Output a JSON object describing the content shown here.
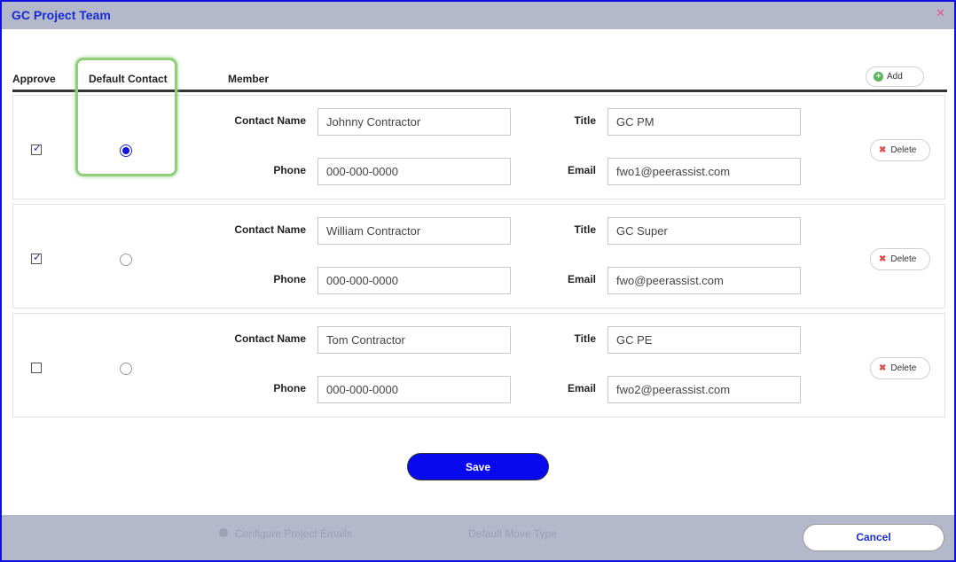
{
  "dialog": {
    "title": "GC Project Team",
    "close_icon": "close-icon"
  },
  "headers": {
    "approve": "Approve",
    "default_contact": "Default Contact",
    "member": "Member",
    "add": "Add"
  },
  "field_labels": {
    "contact_name": "Contact Name",
    "phone": "Phone",
    "title": "Title",
    "email": "Email",
    "delete": "Delete"
  },
  "rows": [
    {
      "approved": true,
      "default": true,
      "contact_name": "Johnny Contractor",
      "phone": "000-000-0000",
      "title": "GC PM",
      "email": "fwo1@peerassist.com"
    },
    {
      "approved": true,
      "default": false,
      "contact_name": "William Contractor",
      "phone": "000-000-0000",
      "title": "GC Super",
      "email": "fwo@peerassist.com"
    },
    {
      "approved": false,
      "default": false,
      "contact_name": "Tom Contractor",
      "phone": "000-000-0000",
      "title": "GC PE",
      "email": "fwo2@peerassist.com"
    }
  ],
  "actions": {
    "save": "Save",
    "cancel": "Cancel"
  },
  "background": {
    "item1": "Configure Project Emails",
    "item2": "Default Move Type"
  },
  "colors": {
    "accent": "#0909f0",
    "title": "#1a2bd6",
    "highlight": "#8fcf7c",
    "titlebar": "#b3b8cb"
  }
}
